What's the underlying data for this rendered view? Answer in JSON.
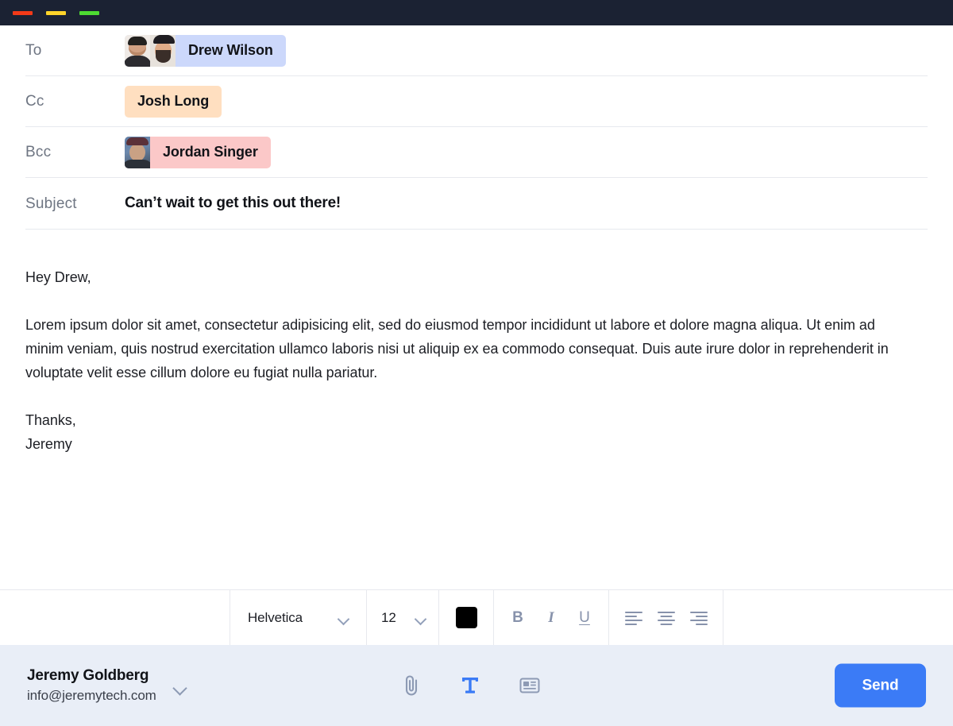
{
  "window": {
    "controls": [
      {
        "name": "close",
        "color": "#f03b20"
      },
      {
        "name": "minimize",
        "color": "#ffd228"
      },
      {
        "name": "maximize",
        "color": "#4ce game"
      }
    ]
  },
  "titlebar": {
    "background": "#1b2233",
    "buttons": [
      {
        "label": "close",
        "color": "#f33a18"
      },
      {
        "label": "minimize",
        "color": "#ffd42a"
      },
      {
        "label": "maximize",
        "color": "#4ddb32"
      }
    ]
  },
  "fields": {
    "to": {
      "label": "To",
      "chips": [
        {
          "name": "Drew Wilson",
          "bg": "#ccd8fb",
          "avatars": 2
        }
      ]
    },
    "cc": {
      "label": "Cc",
      "chips": [
        {
          "name": "Josh Long",
          "bg": "#ffdfc0",
          "avatars": 0
        }
      ]
    },
    "bcc": {
      "label": "Bcc",
      "chips": [
        {
          "name": "Jordan Singer",
          "bg": "#fbc8c8",
          "avatars": 1
        }
      ]
    },
    "subject": {
      "label": "Subject",
      "value": "Can’t wait to get this out there!"
    }
  },
  "body": {
    "greeting": "Hey Drew,",
    "paragraph": "Lorem ipsum dolor sit amet, consectetur adipisicing elit, sed do eiusmod tempor incididunt ut labore et dolore magna aliqua. Ut enim ad minim veniam, quis nostrud exercitation ullamco laboris nisi ut aliquip ex ea commodo consequat. Duis aute irure dolor in reprehenderit in voluptate velit esse cillum dolore eu fugiat nulla pariatur.",
    "signoff": "Thanks,",
    "signature": "Jeremy"
  },
  "toolbar": {
    "font_family": "Helvetica",
    "font_size": "12",
    "text_color": "#000000",
    "bold_label": "B",
    "italic_label": "I",
    "underline_label": "U",
    "align_left": "align-left",
    "align_center": "align-center",
    "align_right": "align-right",
    "icon_color": "#8792ab"
  },
  "footer": {
    "sender_name": "Jeremy Goldberg",
    "sender_email": "info@jeremytech.com",
    "tools": [
      {
        "name": "attachment",
        "icon": "paperclip-icon",
        "color": "#8d9ab4",
        "active": false
      },
      {
        "name": "text-format",
        "icon": "text-format-icon",
        "color": "#3b7bf6",
        "active": true
      },
      {
        "name": "signature",
        "icon": "signature-card-icon",
        "color": "#8d9ab4",
        "active": false
      }
    ],
    "send_label": "Send",
    "send_color": "#3b7bf6",
    "background": "#e9eef7"
  }
}
